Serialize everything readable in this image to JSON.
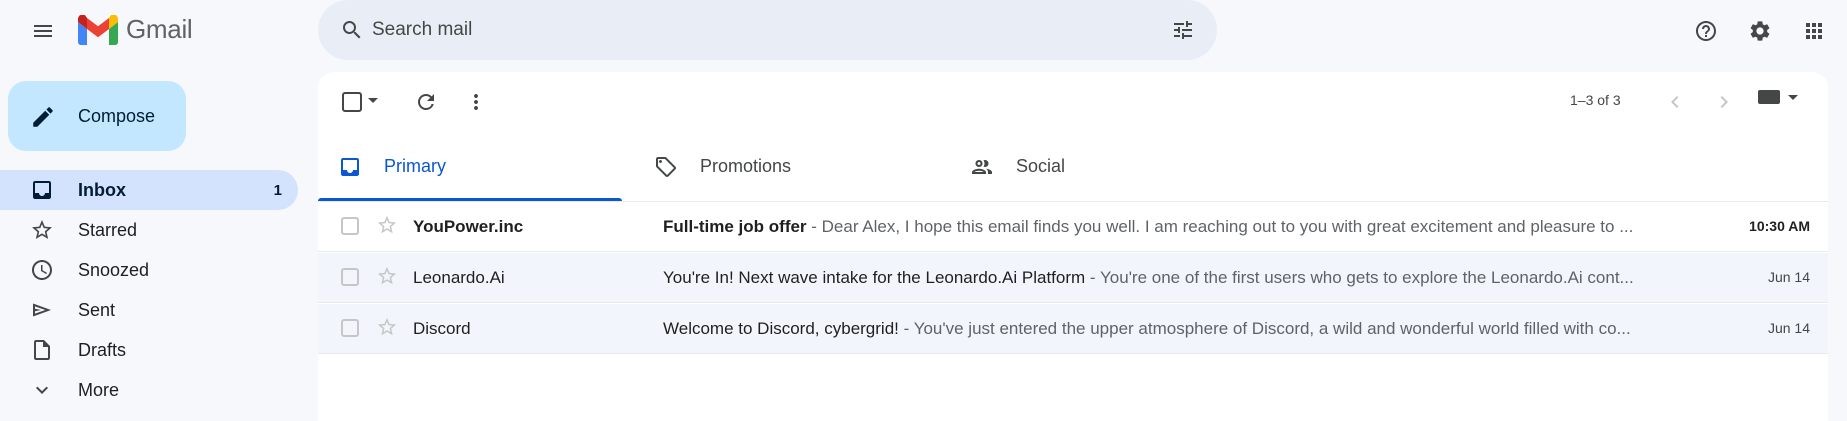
{
  "app": {
    "brand": "Gmail"
  },
  "search": {
    "placeholder": "Search mail"
  },
  "compose": {
    "label": "Compose"
  },
  "sidebar": {
    "items": [
      {
        "label": "Inbox",
        "count": "1",
        "icon": "inbox-icon",
        "active": true
      },
      {
        "label": "Starred",
        "count": "",
        "icon": "star-icon",
        "active": false
      },
      {
        "label": "Snoozed",
        "count": "",
        "icon": "clock-icon",
        "active": false
      },
      {
        "label": "Sent",
        "count": "",
        "icon": "send-icon",
        "active": false
      },
      {
        "label": "Drafts",
        "count": "",
        "icon": "draft-icon",
        "active": false
      },
      {
        "label": "More",
        "count": "",
        "icon": "chevron-down-icon",
        "active": false
      }
    ]
  },
  "toolbar": {
    "pager": "1–3 of 3"
  },
  "tabs": [
    {
      "label": "Primary",
      "icon": "inbox-icon",
      "active": true
    },
    {
      "label": "Promotions",
      "icon": "tag-icon",
      "active": false
    },
    {
      "label": "Social",
      "icon": "people-icon",
      "active": false
    }
  ],
  "emails": [
    {
      "sender": "YouPower.inc",
      "subject": "Full-time job offer",
      "separator": " - ",
      "snippet": "Dear Alex, I hope this email finds you well. I am reaching out to you with great excitement and pleasure to ...",
      "date": "10:30 AM",
      "unread": true
    },
    {
      "sender": "Leonardo.Ai",
      "subject": "You're In! Next wave intake for the Leonardo.Ai Platform",
      "separator": " - ",
      "snippet": "You're one of the first users who gets to explore the Leonardo.Ai cont...",
      "date": "Jun 14",
      "unread": false
    },
    {
      "sender": "Discord",
      "subject": "Welcome to Discord, cybergrid!",
      "separator": " - ",
      "snippet": "You've just entered the upper atmosphere of Discord, a wild and wonderful world filled with co...",
      "date": "Jun 14",
      "unread": false
    }
  ],
  "colors": {
    "accent": "#0b57d0",
    "compose_bg": "#c2e7ff",
    "active_nav_bg": "#d3e3fd",
    "page_bg": "#f6f8fc"
  }
}
